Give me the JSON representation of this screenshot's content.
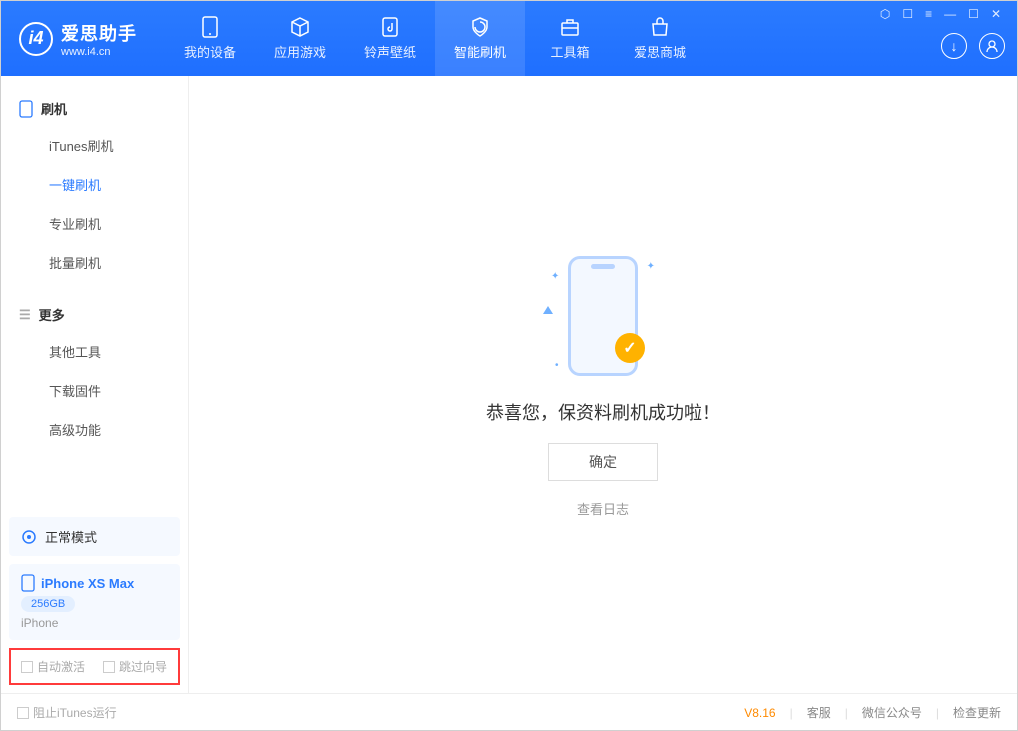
{
  "header": {
    "logo_title": "爱思助手",
    "logo_sub": "www.i4.cn",
    "tabs": [
      {
        "label": "我的设备",
        "icon": "device"
      },
      {
        "label": "应用游戏",
        "icon": "cube"
      },
      {
        "label": "铃声壁纸",
        "icon": "music"
      },
      {
        "label": "智能刷机",
        "icon": "smart",
        "active": true
      },
      {
        "label": "工具箱",
        "icon": "toolbox"
      },
      {
        "label": "爱思商城",
        "icon": "store"
      }
    ],
    "download_icon": "↓",
    "user_icon": "user"
  },
  "sidebar": {
    "group1": {
      "title": "刷机",
      "items": [
        "iTunes刷机",
        "一键刷机",
        "专业刷机",
        "批量刷机"
      ],
      "active_index": 1
    },
    "group2": {
      "title": "更多",
      "items": [
        "其他工具",
        "下载固件",
        "高级功能"
      ]
    },
    "mode": {
      "label": "正常模式"
    },
    "device": {
      "name": "iPhone XS Max",
      "storage": "256GB",
      "type": "iPhone"
    },
    "checks": {
      "auto_activate": "自动激活",
      "skip_guide": "跳过向导"
    }
  },
  "main": {
    "success_text": "恭喜您，保资料刷机成功啦！",
    "ok_button": "确定",
    "log_link": "查看日志"
  },
  "footer": {
    "block_itunes": "阻止iTunes运行",
    "version": "V8.16",
    "links": [
      "客服",
      "微信公众号",
      "检查更新"
    ]
  }
}
